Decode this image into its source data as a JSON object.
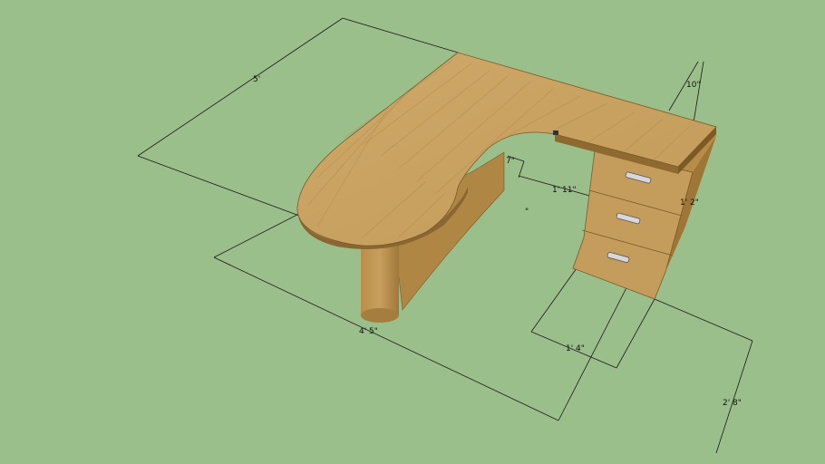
{
  "scene": {
    "background": "#9bbf8a",
    "desk_top_color": "#c9a364",
    "desk_side_color": "#a9813f",
    "desk_dark_color": "#8a6630",
    "edge_color": "#6b4e22"
  },
  "dimensions": {
    "top_width": "5'",
    "wing_depth": "10\"",
    "small_offset": "7\"",
    "cutout_width": "1' 11\"",
    "drawer_height": "1' 2\"",
    "pedestal_depth": "1' 4\"",
    "overall_length": "4' 5\"",
    "desk_height": "2' 8\""
  },
  "stray_mark": "\""
}
